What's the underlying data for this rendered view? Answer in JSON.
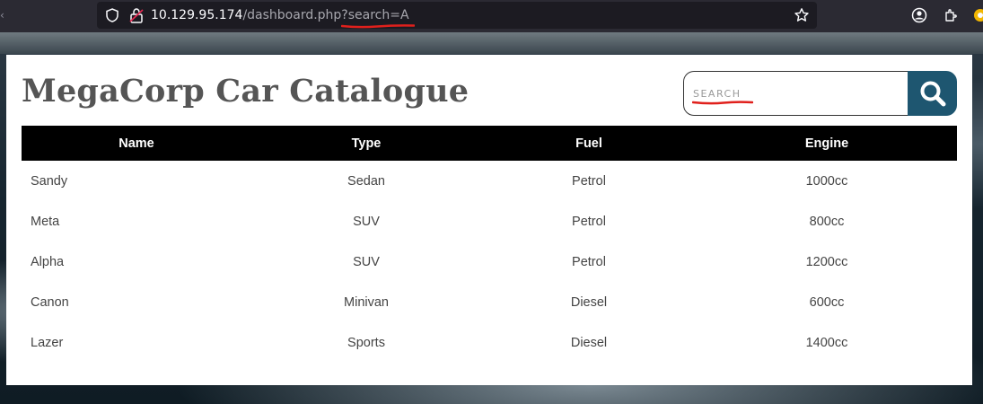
{
  "browser": {
    "url_host": "10.129.95.174",
    "url_path": "/dashboard.php?search=A",
    "icons": {
      "shield": "tracking-shield-icon",
      "lock": "insecure-lock-icon",
      "star": "bookmark-star-icon",
      "account": "account-icon",
      "extensions": "extensions-icon"
    },
    "annotation_color": "#e0201c"
  },
  "page": {
    "title": "MegaCorp Car Catalogue",
    "search": {
      "placeholder": "SEARCH",
      "value": "",
      "button_icon": "search-icon",
      "button_color": "#1e5670"
    },
    "table": {
      "columns": [
        "Name",
        "Type",
        "Fuel",
        "Engine"
      ],
      "rows": [
        {
          "name": "Sandy",
          "type": "Sedan",
          "fuel": "Petrol",
          "engine": "1000cc"
        },
        {
          "name": "Meta",
          "type": "SUV",
          "fuel": "Petrol",
          "engine": "800cc"
        },
        {
          "name": "Alpha",
          "type": "SUV",
          "fuel": "Petrol",
          "engine": "1200cc"
        },
        {
          "name": "Canon",
          "type": "Minivan",
          "fuel": "Diesel",
          "engine": "600cc"
        },
        {
          "name": "Lazer",
          "type": "Sports",
          "fuel": "Diesel",
          "engine": "1400cc"
        }
      ]
    }
  }
}
